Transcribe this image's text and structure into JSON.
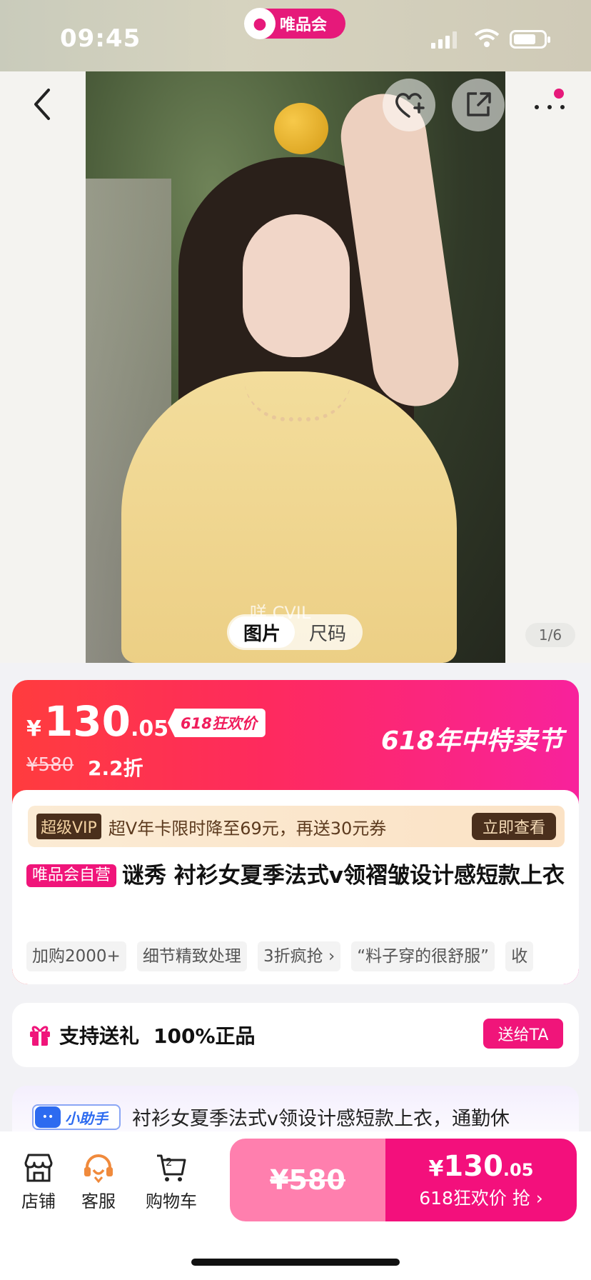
{
  "status_bar": {
    "time": "09:45",
    "brand_label": "唯品会"
  },
  "gallery": {
    "tabs": [
      "图片",
      "尺码"
    ],
    "active_tab": "图片",
    "counter": "1/6",
    "watermark": "咩 CVIL"
  },
  "price": {
    "currency": "¥",
    "integer": "130",
    "decimal": ".05",
    "promo_tag": "618狂欢价",
    "original": "¥580",
    "discount": "2.2折",
    "festival": "618年中特卖节"
  },
  "vip_banner": {
    "tag": "超级VIP",
    "text": "超V年卡限时降至69元，再送30元券",
    "button": "立即查看"
  },
  "product": {
    "self_tag": "唯品会自营",
    "title": "谜秀 衬衫女夏季法式v领褶皱设计感短款上衣"
  },
  "chips": [
    "加购2000+",
    "细节精致处理",
    "3折疯抢 ›",
    "“料子穿的很舒服”",
    "收"
  ],
  "gift_row": {
    "label1": "支持送礼",
    "label2": "100%正品",
    "button": "送给TA"
  },
  "assistant": {
    "tag": "小助手",
    "text": "衬衫女夏季法式v领设计感短款上衣，通勤休"
  },
  "bottom_bar": {
    "store": "店铺",
    "service": "客服",
    "cart": "购物车",
    "cart_count": "2",
    "orig_price": "¥580",
    "buy_currency": "¥",
    "buy_integer": "130",
    "buy_decimal": ".05",
    "buy_label": "618狂欢价  抢 ›"
  },
  "colors": {
    "accent": "#f3107c",
    "price_gradient_start": "#ff3c3e",
    "price_gradient_end": "#f8229c"
  }
}
